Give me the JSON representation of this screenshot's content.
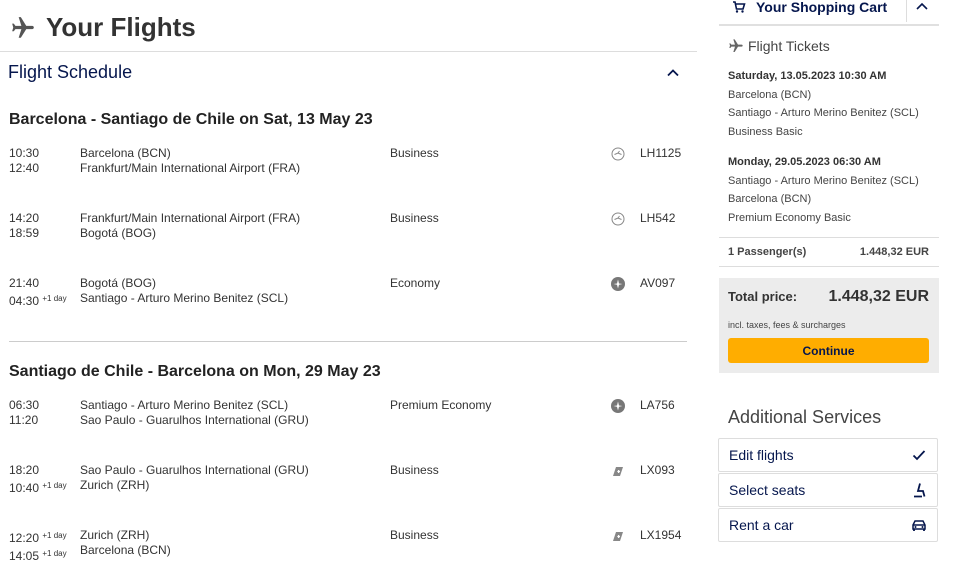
{
  "page": {
    "title": "Your Flights",
    "plane_icon": "plane-icon"
  },
  "schedule": {
    "title": "Flight Schedule"
  },
  "journeys": [
    {
      "title": "Barcelona - Santiago de Chile on Sat, 13 May 23",
      "segments": [
        {
          "dep_time": "10:30",
          "arr_time": "12:40",
          "arr_offset": "",
          "from": "Barcelona (BCN)",
          "to": "Frankfurt/Main International Airport (FRA)",
          "cabin": "Business",
          "carrier_icon": "lufthansa-crane-icon",
          "flight": "LH1125"
        },
        {
          "dep_time": "14:20",
          "arr_time": "18:59",
          "arr_offset": "",
          "from": "Frankfurt/Main International Airport (FRA)",
          "to": "Bogotá (BOG)",
          "cabin": "Business",
          "carrier_icon": "lufthansa-crane-icon",
          "flight": "LH542"
        },
        {
          "dep_time": "21:40",
          "arr_time": "04:30",
          "arr_offset": "+1 day",
          "from": "Bogotá (BOG)",
          "to": "Santiago - Arturo Merino Benitez (SCL)",
          "cabin": "Economy",
          "carrier_icon": "star-alliance-icon",
          "flight": "AV097"
        }
      ]
    },
    {
      "title": "Santiago de Chile - Barcelona on Mon, 29 May 23",
      "segments": [
        {
          "dep_time": "06:30",
          "arr_time": "11:20",
          "arr_offset": "",
          "from": "Santiago - Arturo Merino Benitez (SCL)",
          "to": "Sao Paulo - Guarulhos International (GRU)",
          "cabin": "Premium Economy",
          "carrier_icon": "star-alliance-icon",
          "flight": "LA756"
        },
        {
          "dep_time": "18:20",
          "arr_time": "10:40",
          "arr_offset": "+1 day",
          "from": "Sao Paulo - Guarulhos International (GRU)",
          "to": "Zurich (ZRH)",
          "cabin": "Business",
          "carrier_icon": "swiss-icon",
          "flight": "LX093"
        },
        {
          "dep_time": "12:20",
          "dep_offset": "+1 day",
          "arr_time": "14:05",
          "arr_offset": "+1 day",
          "from": "Zurich (ZRH)",
          "to": "Barcelona (BCN)",
          "cabin": "Business",
          "carrier_icon": "swiss-icon",
          "flight": "LX1954"
        }
      ]
    }
  ],
  "cart": {
    "title": "Your Shopping Cart",
    "tickets_title": "Flight Tickets",
    "outbound": {
      "date": "Saturday, 13.05.2023 10:30 AM",
      "from": "Barcelona (BCN)",
      "to": "Santiago - Arturo Merino Benitez (SCL)",
      "fare": "Business Basic"
    },
    "inbound": {
      "date": "Monday, 29.05.2023 06:30 AM",
      "from": "Santiago - Arturo Merino Benitez (SCL)",
      "to": "Barcelona (BCN)",
      "fare": "Premium Economy Basic"
    },
    "passengers": "1 Passenger(s)",
    "passengers_price": "1.448,32 EUR",
    "total_label": "Total price:",
    "total_amount": "1.448,32 EUR",
    "total_note": "incl. taxes, fees & surcharges",
    "continue_label": "Continue"
  },
  "services": {
    "title": "Additional Services",
    "items": [
      {
        "label": "Edit flights",
        "icon": "checkmark-icon"
      },
      {
        "label": "Select seats",
        "icon": "seat-icon"
      },
      {
        "label": "Rent a car",
        "icon": "car-icon"
      }
    ]
  },
  "colors": {
    "brand_navy": "#05164d",
    "accent_yellow": "#ffad00"
  }
}
